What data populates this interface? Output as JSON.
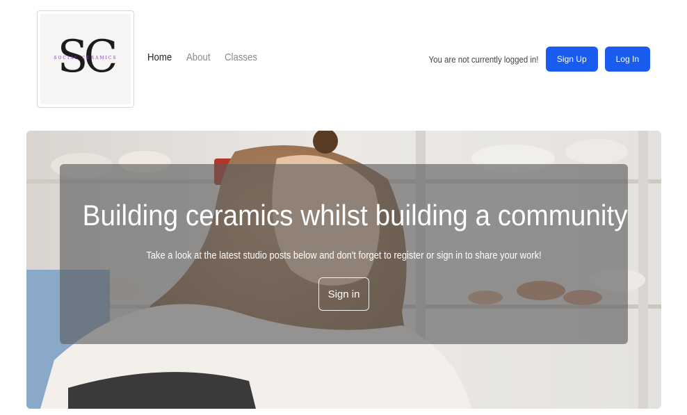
{
  "logo": {
    "letters": "SC",
    "tagline": "SOCIAL CERAMICS"
  },
  "nav": {
    "links": [
      {
        "label": "Home"
      },
      {
        "label": "About"
      },
      {
        "label": "Classes"
      }
    ]
  },
  "auth": {
    "status": "You are not currently logged in!",
    "signup_label": "Sign Up",
    "login_label": "Log In"
  },
  "hero": {
    "title": "Building ceramics whilst building a community",
    "subtitle": "Take a look at the latest studio posts below and don't forget to register or sign in to share your work!",
    "button_label": "Sign in"
  },
  "colors": {
    "primary": "#1a5cf0",
    "overlay": "#5a5a5a",
    "logo_accent": "#7b3fb5"
  }
}
